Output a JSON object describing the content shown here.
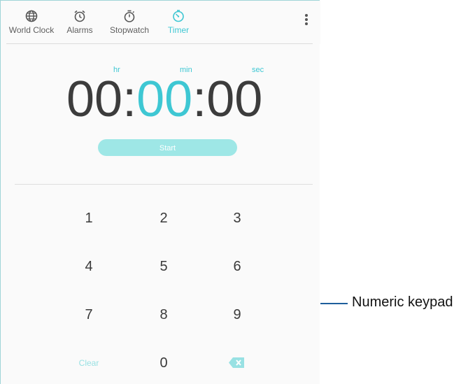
{
  "tabs": [
    {
      "label": "World Clock",
      "icon": "globe-icon",
      "active": false
    },
    {
      "label": "Alarms",
      "icon": "alarm-clock-icon",
      "active": false
    },
    {
      "label": "Stopwatch",
      "icon": "stopwatch-icon",
      "active": false
    },
    {
      "label": "Timer",
      "icon": "timer-icon",
      "active": true
    }
  ],
  "menu": {
    "icon": "more-vertical-icon"
  },
  "timer": {
    "units": {
      "hr": "hr",
      "min": "min",
      "sec": "sec"
    },
    "hours": "00",
    "minutes": "00",
    "seconds": "00",
    "separator": ":",
    "start_label": "Start"
  },
  "keypad": {
    "keys": [
      "1",
      "2",
      "3",
      "4",
      "5",
      "6",
      "7",
      "8",
      "9",
      "Clear",
      "0"
    ],
    "backspace_icon": "backspace-icon"
  },
  "annotation": {
    "label": "Numeric keypad"
  },
  "colors": {
    "accent": "#3ec7d3",
    "start_bg": "#9ee7e6",
    "callout": "#1e5f9c"
  }
}
